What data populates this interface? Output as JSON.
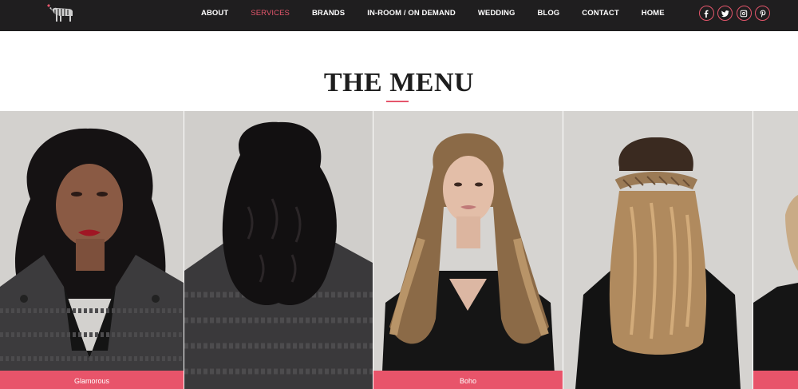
{
  "nav": {
    "items": [
      {
        "label": "ABOUT",
        "active": false
      },
      {
        "label": "SERVICES",
        "active": true
      },
      {
        "label": "BRANDS",
        "active": false
      },
      {
        "label": "IN-ROOM / ON DEMAND",
        "active": false
      },
      {
        "label": "WEDDING",
        "active": false
      },
      {
        "label": "BLOG",
        "active": false
      },
      {
        "label": "CONTACT",
        "active": false
      },
      {
        "label": "HOME",
        "active": false
      }
    ],
    "social": [
      {
        "icon": "facebook-icon"
      },
      {
        "icon": "twitter-icon"
      },
      {
        "icon": "instagram-icon"
      },
      {
        "icon": "pinterest-icon"
      }
    ]
  },
  "page": {
    "title": "THE MENU"
  },
  "gallery": {
    "cards": [
      {
        "label": "Glamorous",
        "view": "front",
        "hair": "dark curls",
        "top": "herringbone coat"
      },
      {
        "label": "",
        "view": "back",
        "hair": "dark curls",
        "top": "herringbone coat"
      },
      {
        "label": "Boho",
        "view": "front",
        "hair": "long ombre waves",
        "top": "black top"
      },
      {
        "label": "",
        "view": "back",
        "hair": "braided half-up waves",
        "top": "black top"
      },
      {
        "label": "",
        "view": "front",
        "hair": "blonde",
        "top": "black top"
      }
    ]
  },
  "colors": {
    "nav_bg": "#1f1e1f",
    "accent": "#e5566c",
    "label_bg": "#e8546a",
    "photo_bg": "#d4d2cf"
  }
}
